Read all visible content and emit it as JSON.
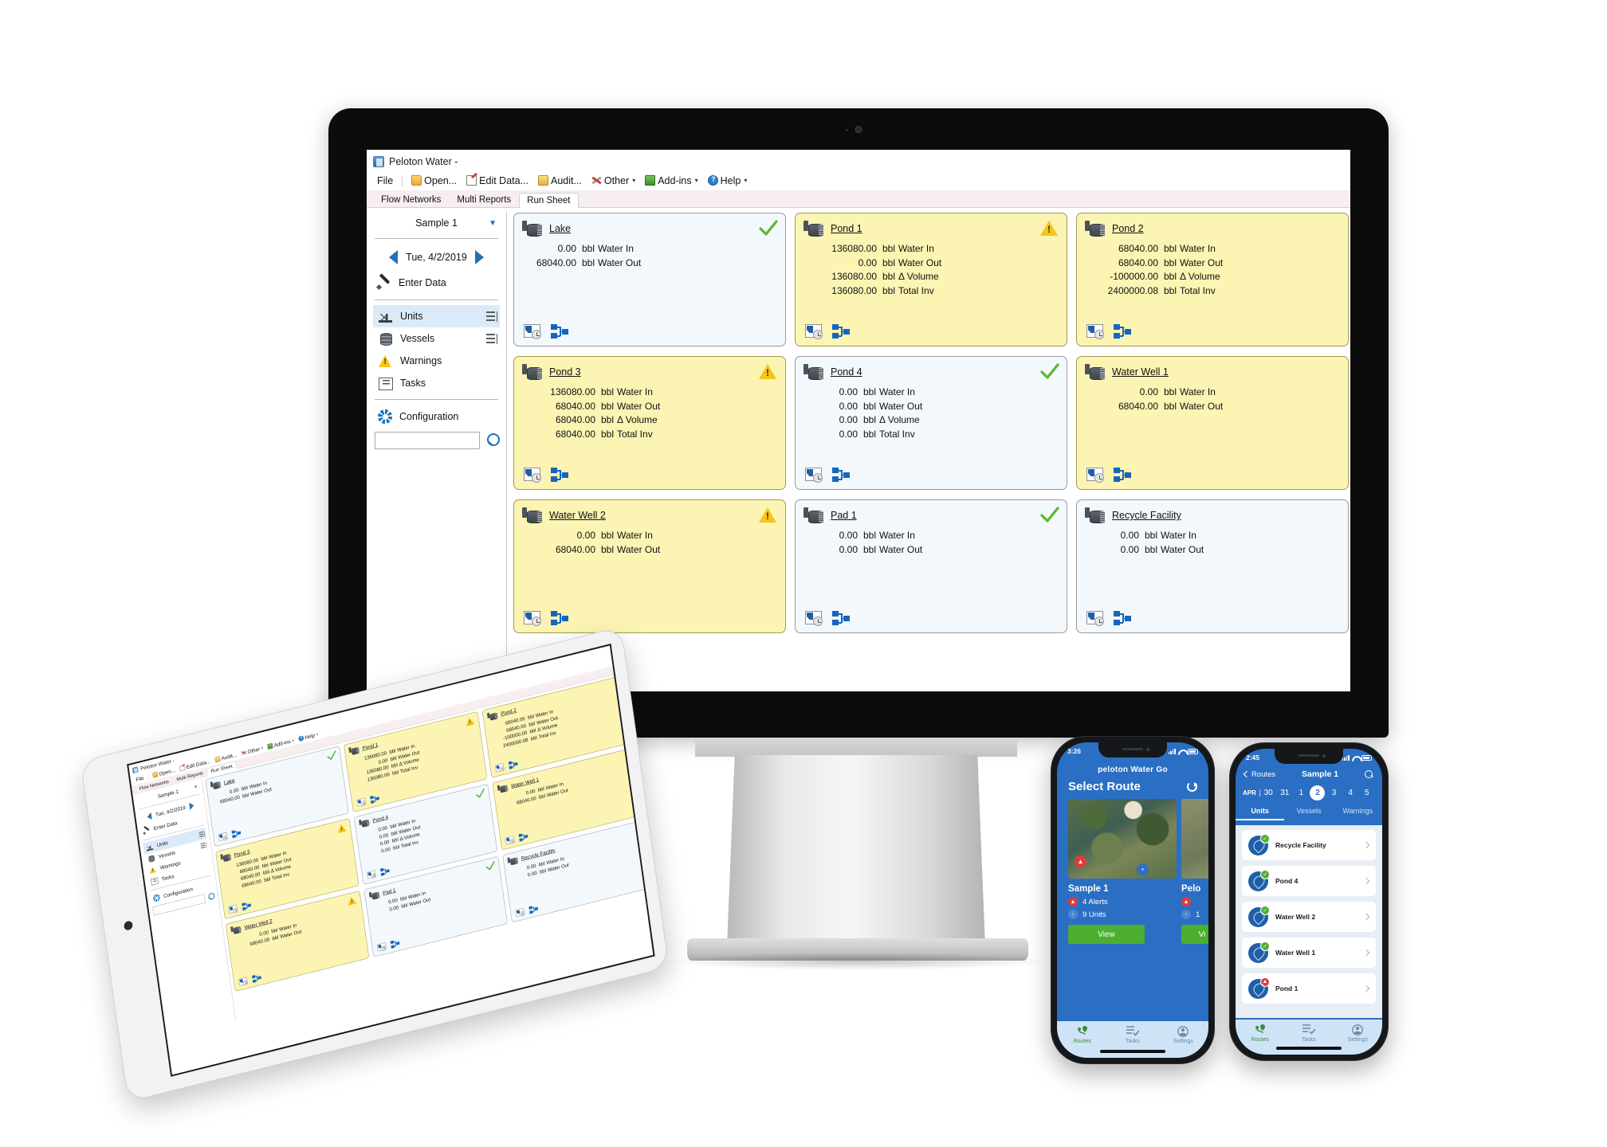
{
  "desktop": {
    "window_title": "Peloton Water -",
    "menu": [
      {
        "label": "File",
        "icon": "",
        "caret": false
      },
      {
        "label": "Open...",
        "icon": "folder-icon",
        "caret": false
      },
      {
        "label": "Edit Data...",
        "icon": "edit-data-icon",
        "caret": false
      },
      {
        "label": "Audit...",
        "icon": "audit-icon",
        "caret": false
      },
      {
        "label": "Other",
        "icon": "tools-icon",
        "caret": true
      },
      {
        "label": "Add-ins",
        "icon": "addins-icon",
        "caret": true
      },
      {
        "label": "Help",
        "icon": "help-icon",
        "caret": true
      }
    ],
    "tabs": [
      {
        "label": "Flow Networks",
        "active": false
      },
      {
        "label": "Multi Reports",
        "active": false
      },
      {
        "label": "Run Sheet",
        "active": true
      }
    ],
    "sidebar": {
      "sample_label": "Sample 1",
      "date_label": "Tue, 4/2/2019",
      "enter_data_label": "Enter Data",
      "nav": [
        {
          "label": "Units",
          "icon": "pumpjack-icon",
          "active": true,
          "handle": true
        },
        {
          "label": "Vessels",
          "icon": "vessel-icon",
          "active": false,
          "handle": true
        },
        {
          "label": "Warnings",
          "icon": "warning-icon",
          "active": false,
          "handle": false
        },
        {
          "label": "Tasks",
          "icon": "tasks-icon",
          "active": false,
          "handle": false
        }
      ],
      "configuration_label": "Configuration",
      "search_value": "",
      "search_placeholder": ""
    },
    "units": [
      {
        "name": "Lake",
        "status": "ok",
        "warn": false,
        "compact": true,
        "metrics": [
          {
            "value": "0.00",
            "unit": "bbl",
            "label": "Water In"
          },
          {
            "value": "68040.00",
            "unit": "bbl",
            "label": "Water Out"
          }
        ]
      },
      {
        "name": "Pond 1",
        "status": "warning",
        "warn": true,
        "compact": false,
        "metrics": [
          {
            "value": "136080.00",
            "unit": "bbl",
            "label": "Water In"
          },
          {
            "value": "0.00",
            "unit": "bbl",
            "label": "Water Out"
          },
          {
            "value": "136080.00",
            "unit": "bbl",
            "label": "Δ Volume"
          },
          {
            "value": "136080.00",
            "unit": "bbl",
            "label": "Total Inv"
          }
        ]
      },
      {
        "name": "Pond 2",
        "status": "none",
        "warn": true,
        "compact": false,
        "metrics": [
          {
            "value": "68040.00",
            "unit": "bbl",
            "label": "Water In"
          },
          {
            "value": "68040.00",
            "unit": "bbl",
            "label": "Water Out"
          },
          {
            "value": "-100000.00",
            "unit": "bbl",
            "label": "Δ Volume"
          },
          {
            "value": "2400000.08",
            "unit": "bbl",
            "label": "Total Inv"
          }
        ]
      },
      {
        "name": "Pond 3",
        "status": "warning",
        "warn": true,
        "compact": false,
        "metrics": [
          {
            "value": "136080.00",
            "unit": "bbl",
            "label": "Water In"
          },
          {
            "value": "68040.00",
            "unit": "bbl",
            "label": "Water Out"
          },
          {
            "value": "68040.00",
            "unit": "bbl",
            "label": "Δ Volume"
          },
          {
            "value": "68040.00",
            "unit": "bbl",
            "label": "Total Inv"
          }
        ]
      },
      {
        "name": "Pond 4",
        "status": "ok",
        "warn": false,
        "compact": true,
        "metrics": [
          {
            "value": "0.00",
            "unit": "bbl",
            "label": "Water In"
          },
          {
            "value": "0.00",
            "unit": "bbl",
            "label": "Water Out"
          },
          {
            "value": "0.00",
            "unit": "bbl",
            "label": "Δ Volume"
          },
          {
            "value": "0.00",
            "unit": "bbl",
            "label": "Total Inv"
          }
        ]
      },
      {
        "name": "Water Well 1",
        "status": "none",
        "warn": true,
        "compact": false,
        "metrics": [
          {
            "value": "0.00",
            "unit": "bbl",
            "label": "Water In"
          },
          {
            "value": "68040.00",
            "unit": "bbl",
            "label": "Water Out"
          }
        ]
      },
      {
        "name": "Water Well 2",
        "status": "warning",
        "warn": true,
        "compact": false,
        "metrics": [
          {
            "value": "0.00",
            "unit": "bbl",
            "label": "Water In"
          },
          {
            "value": "68040.00",
            "unit": "bbl",
            "label": "Water Out"
          }
        ]
      },
      {
        "name": "Pad 1",
        "status": "ok",
        "warn": false,
        "compact": true,
        "metrics": [
          {
            "value": "0.00",
            "unit": "bbl",
            "label": "Water In"
          },
          {
            "value": "0.00",
            "unit": "bbl",
            "label": "Water Out"
          }
        ]
      },
      {
        "name": "Recycle Facility",
        "status": "none",
        "warn": false,
        "compact": true,
        "metrics": [
          {
            "value": "0.00",
            "unit": "bbl",
            "label": "Water In"
          },
          {
            "value": "0.00",
            "unit": "bbl",
            "label": "Water Out"
          }
        ]
      }
    ]
  },
  "phone_routes": {
    "status_time": "3:26",
    "brand": "peloton Water Go",
    "title": "Select Route",
    "cards": [
      {
        "name": "Sample 1",
        "alerts": "4 Alerts",
        "units": "9 Units",
        "button": "View"
      },
      {
        "name": "Pelo",
        "alerts": "",
        "units": "1",
        "button": "Vi"
      }
    ],
    "tabs": [
      {
        "label": "Routes",
        "icon": "routes-icon",
        "active": true
      },
      {
        "label": "Tasks",
        "icon": "tasks-icon",
        "active": false
      },
      {
        "label": "Settings",
        "icon": "settings-icon",
        "active": false
      }
    ]
  },
  "phone_units": {
    "status_time": "2:45",
    "back_label": "Routes",
    "title": "Sample 1",
    "month": "APR",
    "days": [
      "30",
      "31",
      "1",
      "2",
      "3",
      "4",
      "5"
    ],
    "selected_day": "2",
    "segments": [
      {
        "label": "Units",
        "active": true
      },
      {
        "label": "Vessels",
        "active": false
      },
      {
        "label": "Warnings",
        "active": false
      }
    ],
    "list": [
      {
        "name": "Recycle Facility",
        "status": "ok"
      },
      {
        "name": "Pond 4",
        "status": "ok"
      },
      {
        "name": "Water Well 2",
        "status": "ok"
      },
      {
        "name": "Water Well 1",
        "status": "ok"
      },
      {
        "name": "Pond 1",
        "status": "alert"
      }
    ],
    "tabs": [
      {
        "label": "Routes",
        "icon": "routes-icon",
        "active": true
      },
      {
        "label": "Tasks",
        "icon": "tasks-icon",
        "active": false
      },
      {
        "label": "Settings",
        "icon": "settings-icon",
        "active": false
      }
    ]
  },
  "colors": {
    "accent_blue": "#1f72b8",
    "warn_yellow": "#fbf4b3",
    "ok_green": "#5cb82e",
    "alert_red": "#e03b3b",
    "phone_blue": "#2a6fc4"
  }
}
